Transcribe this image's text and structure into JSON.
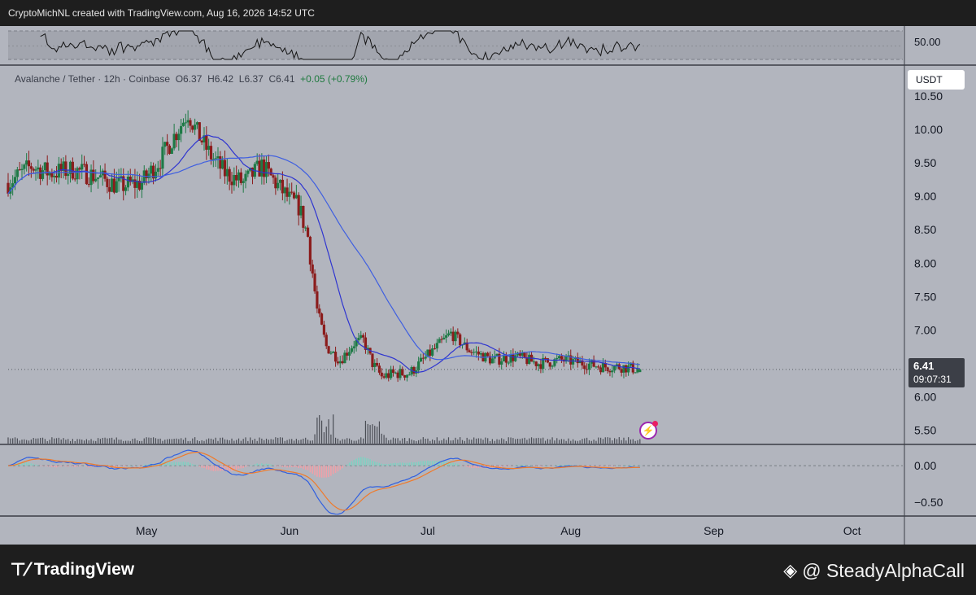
{
  "header": {
    "attribution": "CryptoMichNL created with TradingView.com, Aug 16, 2026 14:52 UTC"
  },
  "legend": {
    "symbol": "Avalanche / Tether · 12h · Coinbase",
    "open": "O6.37",
    "high": "H6.42",
    "low": "L6.37",
    "close": "C6.41",
    "change": "+0.05 (+0.79%)"
  },
  "currency_button": "USDT",
  "last_price": {
    "price": "6.41",
    "countdown": "09:07:31"
  },
  "footer": {
    "brand": "TradingView",
    "handle": "@ SteadyAlphaCall"
  },
  "colors": {
    "background": "#b2b5be",
    "bull": "#1e7a46",
    "bear": "#8b1c1c",
    "ma_fast": "#2f35d0",
    "ma_slow": "#3f5fe0",
    "macd_line": "#2f5fe0",
    "signal_line": "#f07a2a",
    "hist_pos": "#7fd1c2",
    "hist_neg": "#f0a0a8",
    "volume": "#4a4d55",
    "rsi_line": "#141414"
  },
  "chart_data": [
    {
      "type": "candlestick",
      "title": "",
      "x_axis": {
        "type": "time",
        "tick_labels": [
          "May",
          "Jun",
          "Jul",
          "Aug",
          "Sep",
          "Oct"
        ],
        "tick_dates": [
          "2026-05-01",
          "2026-06-01",
          "2026-07-01",
          "2026-08-01",
          "2026-09-01",
          "2026-10-01"
        ],
        "range": [
          "2026-04-01",
          "2026-10-12"
        ]
      },
      "y_axis": {
        "ticks": [
          5.5,
          6.0,
          6.5,
          7.0,
          7.5,
          8.0,
          8.5,
          9.0,
          9.5,
          10.0,
          10.5
        ],
        "tick_labels": [
          "5.50",
          "6.00",
          "6.50",
          "7.00",
          "7.50",
          "8.00",
          "8.50",
          "9.00",
          "9.50",
          "10.00",
          "10.50"
        ],
        "range": [
          5.3,
          10.95
        ]
      },
      "close_anchors": {
        "dates": [
          "2026-04-01",
          "2026-04-06",
          "2026-04-10",
          "2026-04-15",
          "2026-04-20",
          "2026-04-25",
          "2026-04-30",
          "2026-05-04",
          "2026-05-07",
          "2026-05-10",
          "2026-05-12",
          "2026-05-15",
          "2026-05-18",
          "2026-05-22",
          "2026-05-26",
          "2026-05-29",
          "2026-06-01",
          "2026-06-03",
          "2026-06-05",
          "2026-06-07",
          "2026-06-09",
          "2026-06-12",
          "2026-06-15",
          "2026-06-17",
          "2026-06-19",
          "2026-06-21",
          "2026-06-24",
          "2026-06-27",
          "2026-06-30",
          "2026-07-03",
          "2026-07-06",
          "2026-07-10",
          "2026-07-15",
          "2026-07-20",
          "2026-07-25",
          "2026-07-30",
          "2026-08-04",
          "2026-08-08",
          "2026-08-12",
          "2026-08-16"
        ],
        "values": [
          9.2,
          9.45,
          9.35,
          9.4,
          9.3,
          9.15,
          9.2,
          9.55,
          9.9,
          10.25,
          9.95,
          9.6,
          9.35,
          9.2,
          9.45,
          9.2,
          8.95,
          8.85,
          8.4,
          7.3,
          6.75,
          6.55,
          6.8,
          6.85,
          6.5,
          6.3,
          6.35,
          6.35,
          6.55,
          6.75,
          6.95,
          6.7,
          6.55,
          6.6,
          6.5,
          6.55,
          6.5,
          6.45,
          6.45,
          6.41
        ]
      },
      "last": {
        "open": 6.37,
        "high": 6.42,
        "low": 6.37,
        "close": 6.41,
        "change": 0.05,
        "change_pct": 0.79
      },
      "moving_averages": [
        {
          "period_note": "fast",
          "color": "#2f35d0"
        },
        {
          "period_note": "slow",
          "color": "#3f5fe0"
        }
      ]
    },
    {
      "type": "line",
      "panel": "oscillator-top",
      "y_axis": {
        "tick_labels": [
          "50.00"
        ],
        "ticks": [
          50
        ]
      }
    },
    {
      "type": "bar",
      "panel": "volume",
      "note": "volume spikes near early June sell-off and mid June low"
    },
    {
      "type": "line",
      "panel": "macd",
      "y_axis": {
        "ticks": [
          0.0,
          -0.5
        ],
        "tick_labels": [
          "0.00",
          "−0.50"
        ],
        "range": [
          -0.68,
          0.28
        ]
      },
      "series": [
        {
          "color": "#2f5fe0"
        },
        {
          "color": "#f07a2a"
        }
      ]
    }
  ]
}
